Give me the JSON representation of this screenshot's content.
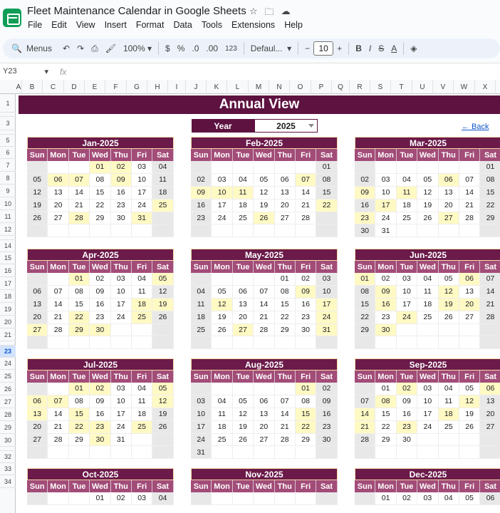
{
  "doc": {
    "title": "Fleet Maintenance Calendar in Google Sheets",
    "icons": [
      "star-icon",
      "folder-move-icon",
      "cloud-icon"
    ]
  },
  "menubar": [
    "File",
    "Edit",
    "View",
    "Insert",
    "Format",
    "Data",
    "Tools",
    "Extensions",
    "Help"
  ],
  "toolbar": {
    "menus_label": "Menus",
    "zoom": "100%",
    "currency": "$",
    "percent": "%",
    "dec_decrease": ".0",
    "dec_increase": ".00",
    "number_format": "123",
    "font": "Defaul...",
    "font_size": "10",
    "minus": "−",
    "plus": "+",
    "bold": "B",
    "italic": "I",
    "strike": "S",
    "text_color": "A"
  },
  "formula_bar": {
    "cell_ref": "Y23",
    "fx": "fx"
  },
  "columns": [
    "A",
    "B",
    "C",
    "D",
    "E",
    "F",
    "G",
    "H",
    "I",
    "J",
    "K",
    "L",
    "M",
    "N",
    "O",
    "P",
    "Q",
    "R",
    "S",
    "T",
    "U",
    "V",
    "W",
    "X"
  ],
  "rows": [
    "1",
    "2",
    "3",
    "4",
    "5",
    "6",
    "7",
    "8",
    "9",
    "10",
    "11",
    "12",
    "13",
    "14",
    "15",
    "16",
    "17",
    "18",
    "19",
    "20",
    "21",
    "22",
    "23",
    "24",
    "25",
    "26",
    "27",
    "28",
    "29",
    "30",
    "31",
    "32",
    "33",
    "34"
  ],
  "selected_row": "23",
  "sheet": {
    "banner": "Annual View",
    "year_label": "Year",
    "year_value": "2025",
    "back_link": "← Back"
  },
  "weekdays": [
    "Sun",
    "Mon",
    "Tue",
    "Wed",
    "Thu",
    "Fri",
    "Sat"
  ],
  "colors": {
    "banner": "#5d1240",
    "month_header": "#6b1a4a",
    "weekday_header": "#a24c78",
    "highlight": "#fff9c4",
    "weekend": "#e8e8e8"
  },
  "months": [
    {
      "name": "Jan-2025",
      "weeks": [
        [
          "",
          "",
          "",
          "01",
          "02",
          "03",
          "04"
        ],
        [
          "05",
          "06",
          "07",
          "08",
          "09",
          "10",
          "11"
        ],
        [
          "12",
          "13",
          "14",
          "15",
          "16",
          "17",
          "18"
        ],
        [
          "19",
          "20",
          "21",
          "22",
          "23",
          "24",
          "25"
        ],
        [
          "26",
          "27",
          "28",
          "29",
          "30",
          "31",
          ""
        ],
        [
          "",
          "",
          "",
          "",
          "",
          "",
          ""
        ]
      ],
      "highlights": [
        "01",
        "02",
        "06",
        "07",
        "09",
        "25",
        "28",
        "31"
      ]
    },
    {
      "name": "Feb-2025",
      "weeks": [
        [
          "",
          "",
          "",
          "",
          "",
          "",
          "01"
        ],
        [
          "02",
          "03",
          "04",
          "05",
          "06",
          "07",
          "08"
        ],
        [
          "09",
          "10",
          "11",
          "12",
          "13",
          "14",
          "15"
        ],
        [
          "16",
          "17",
          "18",
          "19",
          "20",
          "21",
          "22"
        ],
        [
          "23",
          "24",
          "25",
          "26",
          "27",
          "28",
          ""
        ],
        [
          "",
          "",
          "",
          "",
          "",
          "",
          ""
        ]
      ],
      "highlights": [
        "07",
        "09",
        "10",
        "11",
        "22",
        "26"
      ]
    },
    {
      "name": "Mar-2025",
      "weeks": [
        [
          "",
          "",
          "",
          "",
          "",
          "",
          "01"
        ],
        [
          "02",
          "03",
          "04",
          "05",
          "06",
          "07",
          "08"
        ],
        [
          "09",
          "10",
          "11",
          "12",
          "13",
          "14",
          "15"
        ],
        [
          "16",
          "17",
          "18",
          "19",
          "20",
          "21",
          "22"
        ],
        [
          "23",
          "24",
          "25",
          "26",
          "27",
          "28",
          "29"
        ],
        [
          "30",
          "31",
          "",
          "",
          "",
          "",
          ""
        ]
      ],
      "highlights": [
        "06",
        "09",
        "11",
        "17",
        "23",
        "27"
      ]
    },
    {
      "name": "Apr-2025",
      "weeks": [
        [
          "",
          "",
          "01",
          "02",
          "03",
          "04",
          "05"
        ],
        [
          "06",
          "07",
          "08",
          "09",
          "10",
          "11",
          "12"
        ],
        [
          "13",
          "14",
          "15",
          "16",
          "17",
          "18",
          "19"
        ],
        [
          "20",
          "21",
          "22",
          "23",
          "24",
          "25",
          "26"
        ],
        [
          "27",
          "28",
          "29",
          "30",
          "",
          "",
          ""
        ],
        [
          "",
          "",
          "",
          "",
          "",
          "",
          ""
        ]
      ],
      "highlights": [
        "01",
        "05",
        "18",
        "19",
        "22",
        "25",
        "27",
        "29",
        "30"
      ]
    },
    {
      "name": "May-2025",
      "weeks": [
        [
          "",
          "",
          "",
          "",
          "01",
          "02",
          "03"
        ],
        [
          "04",
          "05",
          "06",
          "07",
          "08",
          "09",
          "10"
        ],
        [
          "11",
          "12",
          "13",
          "14",
          "15",
          "16",
          "17"
        ],
        [
          "18",
          "19",
          "20",
          "21",
          "22",
          "23",
          "24"
        ],
        [
          "25",
          "26",
          "27",
          "28",
          "29",
          "30",
          "31"
        ],
        [
          "",
          "",
          "",
          "",
          "",
          "",
          ""
        ]
      ],
      "highlights": [
        "09",
        "12",
        "17",
        "24",
        "27",
        "31"
      ]
    },
    {
      "name": "Jun-2025",
      "weeks": [
        [
          "01",
          "02",
          "03",
          "04",
          "05",
          "06",
          "07"
        ],
        [
          "08",
          "09",
          "10",
          "11",
          "12",
          "13",
          "14"
        ],
        [
          "15",
          "16",
          "17",
          "18",
          "19",
          "20",
          "21"
        ],
        [
          "22",
          "23",
          "24",
          "25",
          "26",
          "27",
          "28"
        ],
        [
          "29",
          "30",
          "",
          "",
          "",
          "",
          ""
        ],
        [
          "",
          "",
          "",
          "",
          "",
          "",
          ""
        ]
      ],
      "highlights": [
        "01",
        "06",
        "09",
        "12",
        "16",
        "19",
        "20",
        "24",
        "30"
      ]
    },
    {
      "name": "Jul-2025",
      "weeks": [
        [
          "",
          "",
          "01",
          "02",
          "03",
          "04",
          "05"
        ],
        [
          "06",
          "07",
          "08",
          "09",
          "10",
          "11",
          "12"
        ],
        [
          "13",
          "14",
          "15",
          "16",
          "17",
          "18",
          "19"
        ],
        [
          "20",
          "21",
          "22",
          "23",
          "24",
          "25",
          "26"
        ],
        [
          "27",
          "28",
          "29",
          "30",
          "31",
          "",
          ""
        ],
        [
          "",
          "",
          "",
          "",
          "",
          "",
          ""
        ]
      ],
      "highlights": [
        "01",
        "02",
        "05",
        "06",
        "07",
        "12",
        "13",
        "15",
        "22",
        "23",
        "25",
        "30"
      ]
    },
    {
      "name": "Aug-2025",
      "weeks": [
        [
          "",
          "",
          "",
          "",
          "",
          "01",
          "02"
        ],
        [
          "03",
          "04",
          "05",
          "06",
          "07",
          "08",
          "09"
        ],
        [
          "10",
          "11",
          "12",
          "13",
          "14",
          "15",
          "16"
        ],
        [
          "17",
          "18",
          "19",
          "20",
          "21",
          "22",
          "23"
        ],
        [
          "24",
          "25",
          "26",
          "27",
          "28",
          "29",
          "30"
        ],
        [
          "31",
          "",
          "",
          "",
          "",
          "",
          ""
        ]
      ],
      "highlights": [
        "01",
        "15",
        "22"
      ]
    },
    {
      "name": "Sep-2025",
      "weeks": [
        [
          "",
          "01",
          "02",
          "03",
          "04",
          "05",
          "06"
        ],
        [
          "07",
          "08",
          "09",
          "10",
          "11",
          "12",
          "13"
        ],
        [
          "14",
          "15",
          "16",
          "17",
          "18",
          "19",
          "20"
        ],
        [
          "21",
          "22",
          "23",
          "24",
          "25",
          "26",
          "27"
        ],
        [
          "28",
          "29",
          "30",
          "",
          "",
          "",
          ""
        ],
        [
          "",
          "",
          "",
          "",
          "",
          "",
          ""
        ]
      ],
      "highlights": [
        "02",
        "06",
        "08",
        "12",
        "14",
        "18",
        "21",
        "23"
      ]
    },
    {
      "name": "Oct-2025",
      "weeks": [
        [
          "",
          "",
          "",
          "01",
          "02",
          "03",
          "04"
        ]
      ],
      "highlights": []
    },
    {
      "name": "Nov-2025",
      "weeks": [
        [
          "",
          "",
          "",
          "",
          "",
          "",
          ""
        ]
      ],
      "highlights": []
    },
    {
      "name": "Dec-2025",
      "weeks": [
        [
          "",
          "01",
          "02",
          "03",
          "04",
          "05",
          "06"
        ]
      ],
      "highlights": []
    }
  ]
}
